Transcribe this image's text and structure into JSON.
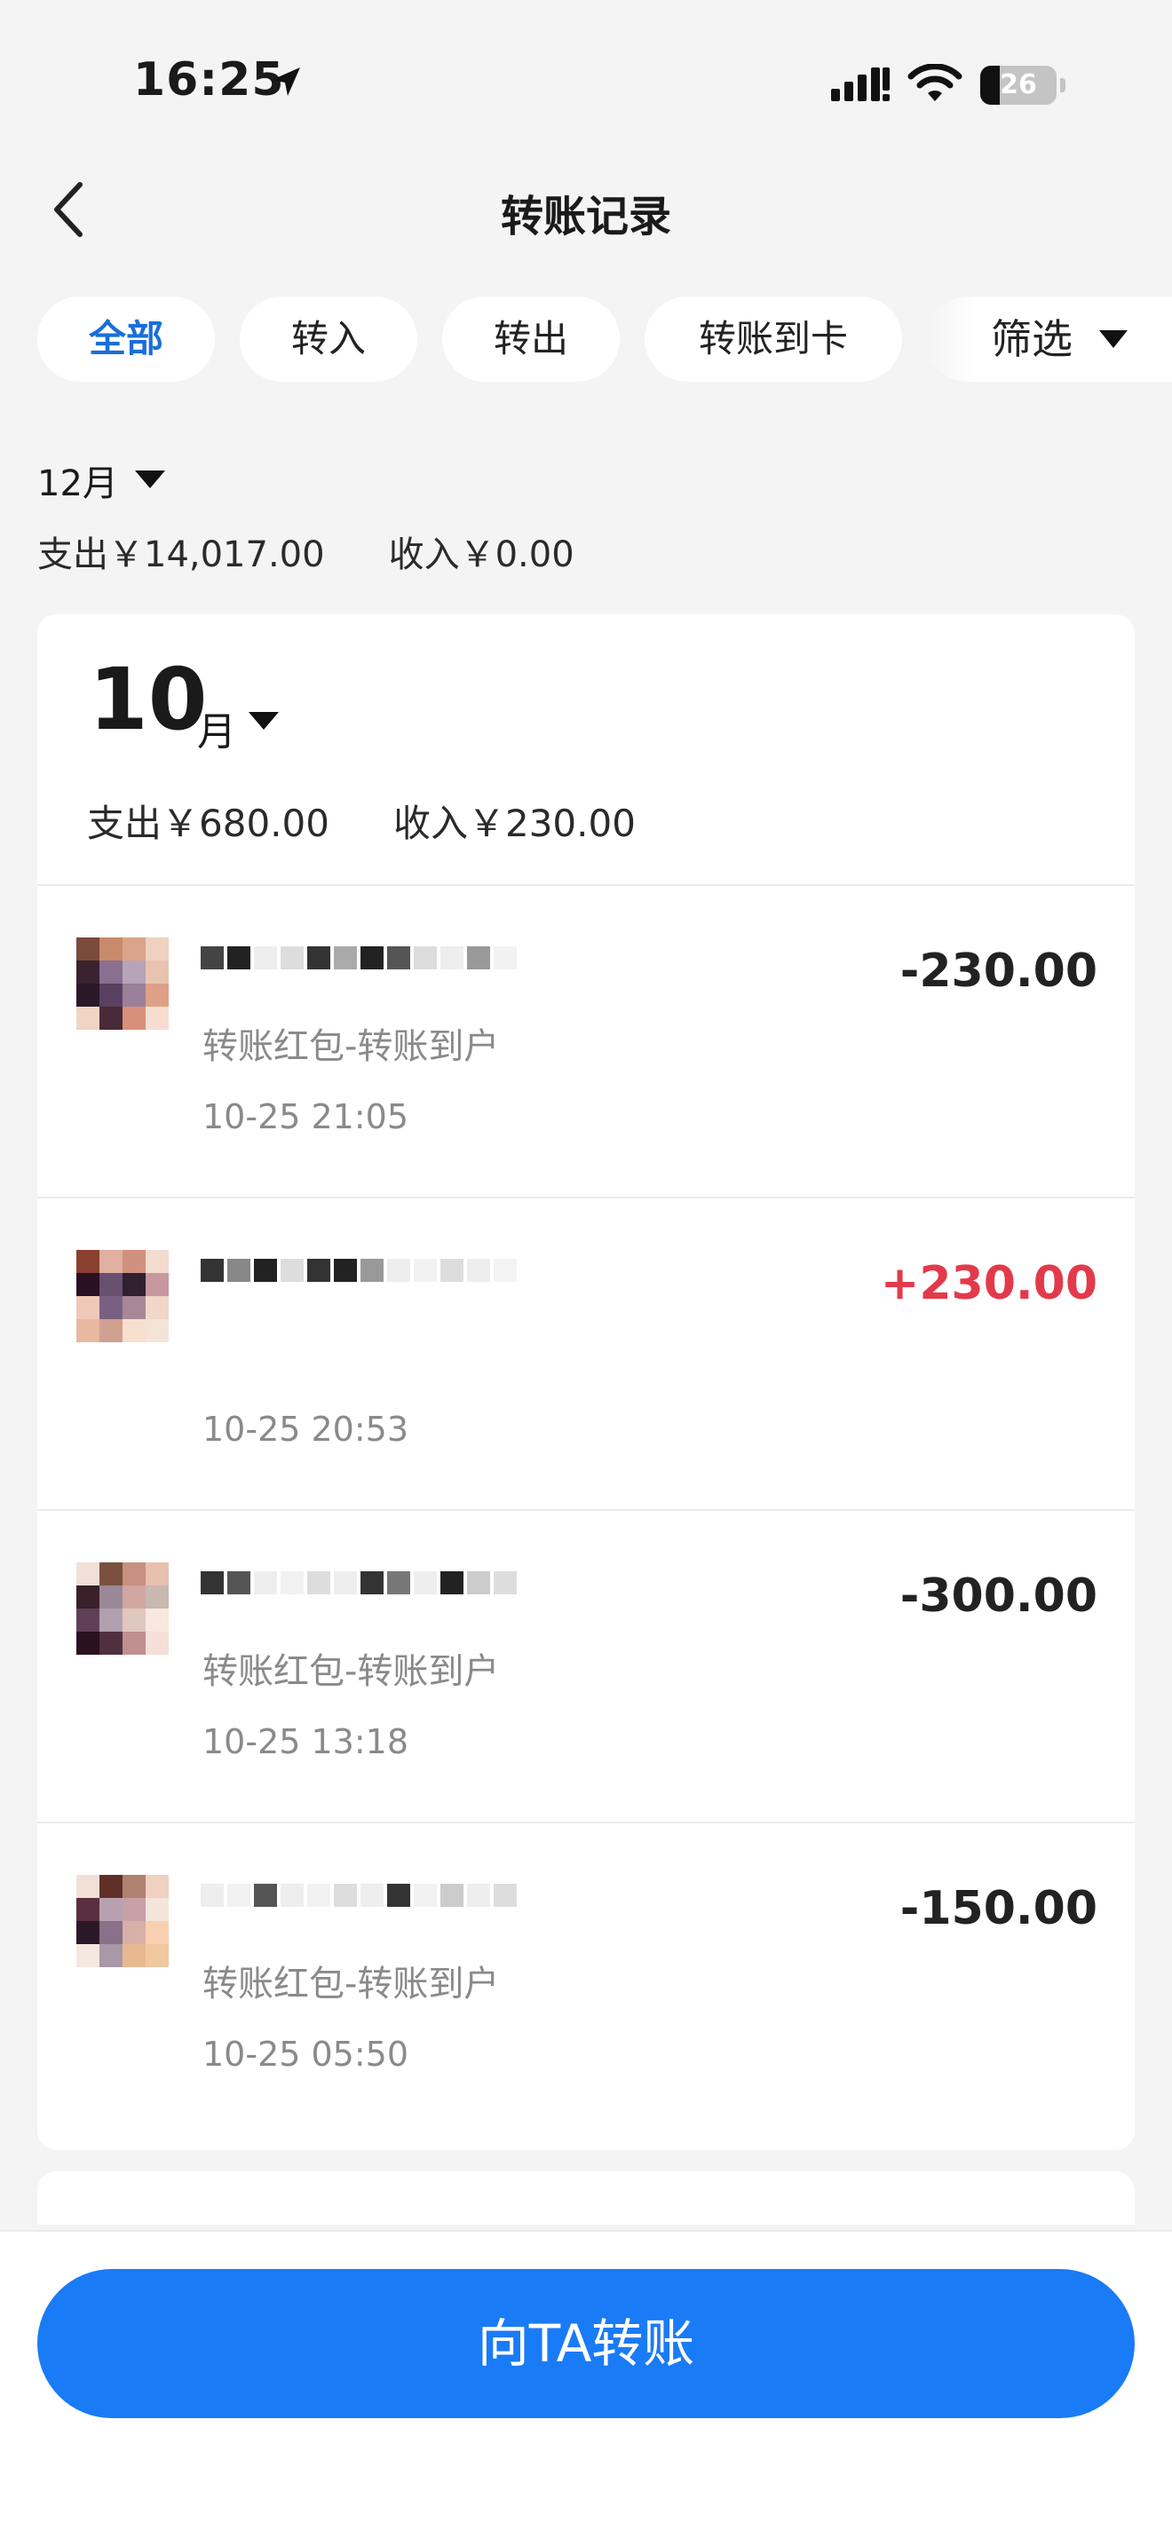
{
  "status_bar": {
    "time": "16:25",
    "battery_level": "26",
    "battery_fraction": 0.26,
    "icons": [
      "location-arrow-icon",
      "cellular-signal-icon",
      "wifi-icon",
      "battery-icon"
    ]
  },
  "nav": {
    "back_icon": "chevron-left-icon",
    "title": "转账记录"
  },
  "filters": {
    "chips": [
      {
        "label": "全部",
        "active": true
      },
      {
        "label": "转入",
        "active": false
      },
      {
        "label": "转出",
        "active": false
      },
      {
        "label": "转账到卡",
        "active": false
      }
    ],
    "filter_label": "筛选",
    "filter_icon": "caret-down-icon"
  },
  "summary_dec": {
    "month": "12月",
    "expense": "支出￥14,017.00",
    "income": "收入￥0.00"
  },
  "month_group": {
    "month_number": "10",
    "month_unit": "月",
    "expense": "支出￥680.00",
    "income": "收入￥230.00",
    "transactions": [
      {
        "desc": "转账红包-转账到户",
        "time": "10-25 21:05",
        "amount": "-230.00",
        "direction": "out"
      },
      {
        "desc": "",
        "time": "10-25 20:53",
        "amount": "+230.00",
        "direction": "in"
      },
      {
        "desc": "转账红包-转账到户",
        "time": "10-25 13:18",
        "amount": "-300.00",
        "direction": "out"
      },
      {
        "desc": "转账红包-转账到户",
        "time": "10-25 05:50",
        "amount": "-150.00",
        "direction": "out"
      }
    ]
  },
  "colors": {
    "accent": "#1a7bf6",
    "active_chip_text": "#1a6ed8",
    "income_amount": "#e33a4b",
    "background": "#f4f4f4"
  },
  "bottom": {
    "transfer_button_label": "向TA转账"
  }
}
